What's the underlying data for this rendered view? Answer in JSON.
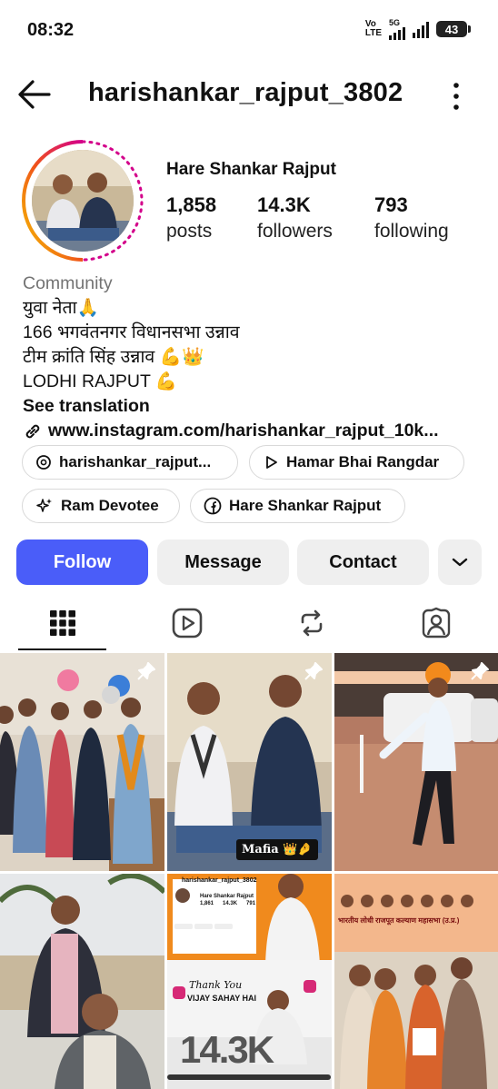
{
  "status_bar": {
    "time": "08:32",
    "volte_top": "Vo",
    "volte_bottom": "LTE",
    "network": "5G",
    "battery": "43"
  },
  "header": {
    "username": "harishankar_rajput_3802",
    "back_icon": "arrow-left-icon",
    "more_icon": "vertical-dots-icon"
  },
  "profile": {
    "display_name": "Hare Shankar Rajput",
    "stats": [
      {
        "value": "1,858",
        "label": "posts"
      },
      {
        "value": "14.3K",
        "label": "followers"
      },
      {
        "value": "793",
        "label": "following"
      }
    ]
  },
  "bio": {
    "category": "Community",
    "lines": [
      "युवा नेता🙏",
      "166 भगवंतनगर विधानसभा उन्नाव",
      "टीम क्रांति सिंह उन्नाव 💪👑",
      "LODHI RAJPUT 💪"
    ],
    "see_translation": "See translation",
    "link": "www.instagram.com/harishankar_rajput_10k..."
  },
  "chips": [
    {
      "label": "harishankar_rajput...",
      "icon": "threads-icon"
    },
    {
      "label": "Hamar Bhai Rangdar",
      "icon": "play-icon"
    },
    {
      "label": "Ram Devotee",
      "icon": "sparkle-icon"
    },
    {
      "label": "Hare Shankar Rajput",
      "icon": "facebook-icon"
    }
  ],
  "actions": {
    "follow": "Follow",
    "message": "Message",
    "contact": "Contact"
  },
  "tabs": [
    "grid-icon",
    "reels-icon",
    "reposts-icon",
    "tagged-icon"
  ],
  "posts": {
    "tile2_caption": "Mafia 👑🤌",
    "tile5": {
      "username": "harishankar_rajput_3802",
      "name": "Hare Shankar Rajput",
      "stats": [
        "1,861",
        "14.3K",
        "791"
      ],
      "thank_you": "Thank You",
      "vijay": "VIJAY SAHAY HAI",
      "big": "14.3K"
    },
    "tile6_banner": "भारतीय लोधी राजपूत कल्याण महासभा (उ.प्र.)"
  },
  "colors": {
    "follow_button": "#4a5df9",
    "secondary_button": "#efefef",
    "story_ring_start": "#f5c400",
    "story_ring_end": "#d3008a"
  }
}
